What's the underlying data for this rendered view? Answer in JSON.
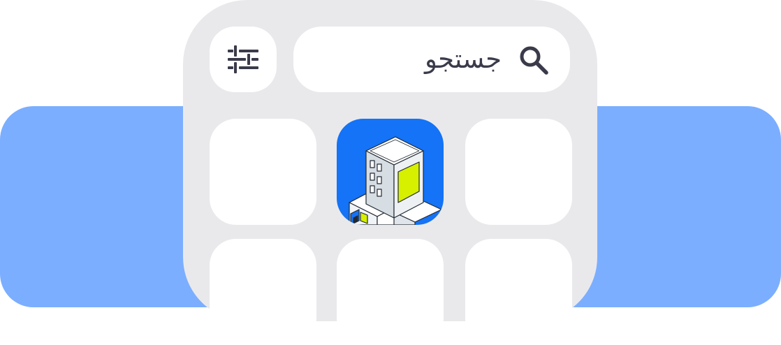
{
  "search": {
    "placeholder": "جستجو",
    "icon": "search-icon"
  },
  "filter": {
    "icon": "sliders-icon"
  },
  "app_icon": {
    "icon": "building-icon"
  },
  "colors": {
    "band": "#7baeff",
    "phone_frame": "#e9e9ec",
    "tile": "#ffffff",
    "icon_text": "#3a3b4a",
    "app_icon_bg": "#1473f6",
    "building_accent": "#d6f000"
  }
}
